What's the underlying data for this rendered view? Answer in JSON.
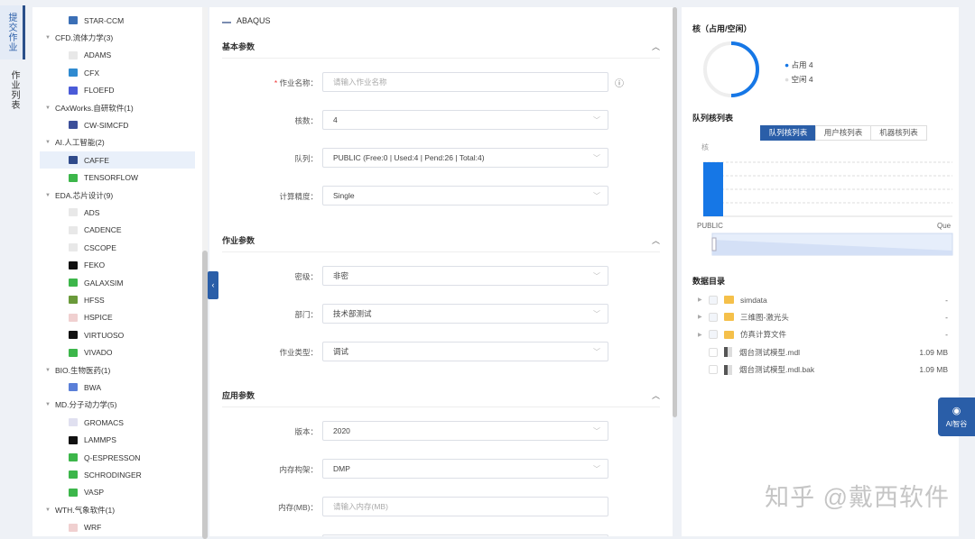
{
  "nav": {
    "tabs": [
      {
        "label": "提交作业",
        "active": true
      },
      {
        "label": "作业列表",
        "active": false
      }
    ]
  },
  "tree": [
    {
      "type": "app",
      "label": "STAR-CCM",
      "color": "#3b6fb6"
    },
    {
      "type": "cat",
      "label": "CFD.流体力学(3)"
    },
    {
      "type": "app",
      "label": "ADAMS",
      "color": "#e8e8e8"
    },
    {
      "type": "app",
      "label": "CFX",
      "color": "#2f8ad0"
    },
    {
      "type": "app",
      "label": "FLOEFD",
      "color": "#4a5bd8"
    },
    {
      "type": "cat",
      "label": "CAxWorks.自研软件(1)"
    },
    {
      "type": "app",
      "label": "CW-SIMCFD",
      "color": "#3c4f9a"
    },
    {
      "type": "cat",
      "label": "AI.人工智能(2)"
    },
    {
      "type": "app",
      "label": "CAFFE",
      "color": "#2f4a8a",
      "selected": true
    },
    {
      "type": "app",
      "label": "TENSORFLOW",
      "color": "#3cb64a"
    },
    {
      "type": "cat",
      "label": "EDA.芯片设计(9)"
    },
    {
      "type": "app",
      "label": "ADS",
      "color": "#e8e8e8"
    },
    {
      "type": "app",
      "label": "CADENCE",
      "color": "#e8e8e8"
    },
    {
      "type": "app",
      "label": "CSCOPE",
      "color": "#e8e8e8"
    },
    {
      "type": "app",
      "label": "FEKO",
      "color": "#111111"
    },
    {
      "type": "app",
      "label": "GALAXSIM",
      "color": "#3cb64a"
    },
    {
      "type": "app",
      "label": "HFSS",
      "color": "#6a9a3a"
    },
    {
      "type": "app",
      "label": "HSPICE",
      "color": "#f0d0d0"
    },
    {
      "type": "app",
      "label": "VIRTUOSO",
      "color": "#111111"
    },
    {
      "type": "app",
      "label": "VIVADO",
      "color": "#3cb64a"
    },
    {
      "type": "cat",
      "label": "BIO.生物医药(1)"
    },
    {
      "type": "app",
      "label": "BWA",
      "color": "#5a7fd8"
    },
    {
      "type": "cat",
      "label": "MD.分子动力学(5)"
    },
    {
      "type": "app",
      "label": "GROMACS",
      "color": "#e0e0f0"
    },
    {
      "type": "app",
      "label": "LAMMPS",
      "color": "#111111"
    },
    {
      "type": "app",
      "label": "Q-ESPRESSON",
      "color": "#3cb64a"
    },
    {
      "type": "app",
      "label": "SCHRODINGER",
      "color": "#3cb64a"
    },
    {
      "type": "app",
      "label": "VASP",
      "color": "#3cb64a"
    },
    {
      "type": "cat",
      "label": "WTH.气象软件(1)"
    },
    {
      "type": "app",
      "label": "WRF",
      "color": "#f0d0d0"
    }
  ],
  "form": {
    "app_title": "ABAQUS",
    "sections": [
      {
        "title": "基本参数",
        "fields": [
          {
            "label": "作业名称：",
            "required": true,
            "value": "",
            "placeholder": "请输入作业名称",
            "type": "input",
            "info": true
          },
          {
            "label": "核数：",
            "value": "4",
            "type": "select"
          },
          {
            "label": "队列：",
            "value": "PUBLIC (Free:0 | Used:4 | Pend:26 | Total:4)",
            "type": "select"
          },
          {
            "label": "计算精度：",
            "value": "Single",
            "type": "select"
          }
        ]
      },
      {
        "title": "作业参数",
        "fields": [
          {
            "label": "密级：",
            "value": "非密",
            "type": "select"
          },
          {
            "label": "部门：",
            "value": "技术部测试",
            "type": "select"
          },
          {
            "label": "作业类型：",
            "value": "调试",
            "type": "select"
          }
        ]
      },
      {
        "title": "应用参数",
        "fields": [
          {
            "label": "版本：",
            "value": "2020",
            "type": "select"
          },
          {
            "label": "内存构架：",
            "value": "DMP",
            "type": "select"
          },
          {
            "label": "内存(MB)：",
            "value": "",
            "placeholder": "请输入内存(MB)",
            "type": "input"
          }
        ]
      }
    ]
  },
  "cores": {
    "title": "核（占用/空闲）",
    "used_label": "占用 4",
    "free_label": "空闲 4",
    "used": 4,
    "free": 4,
    "used_color": "#1677e6",
    "free_color": "#eeeeee"
  },
  "queue": {
    "title": "队列核列表",
    "tabs": [
      "队列核列表",
      "用户核列表",
      "机器核列表"
    ],
    "active_tab": 0
  },
  "chart_data": {
    "type": "bar",
    "categories": [
      "PUBLIC"
    ],
    "values": [
      4
    ],
    "ylabel": "核",
    "xlabel": "Que",
    "ylim": [
      0,
      4
    ],
    "y_ticks": [
      "4",
      "0"
    ],
    "color": "#1677e6"
  },
  "data_dir": {
    "title": "数据目录",
    "items": [
      {
        "name": "simdata",
        "size": "-",
        "folder": true
      },
      {
        "name": "三维图-激光头",
        "size": "-",
        "folder": true
      },
      {
        "name": "仿真计算文件",
        "size": "-",
        "folder": true
      },
      {
        "name": "烟台测试模型.mdl",
        "size": "1.09 MB",
        "folder": false
      },
      {
        "name": "烟台测试模型.mdl.bak",
        "size": "1.09 MB",
        "folder": false
      }
    ]
  },
  "ai_button": {
    "label": "AI智谷"
  },
  "watermark": "知乎 @戴西软件"
}
